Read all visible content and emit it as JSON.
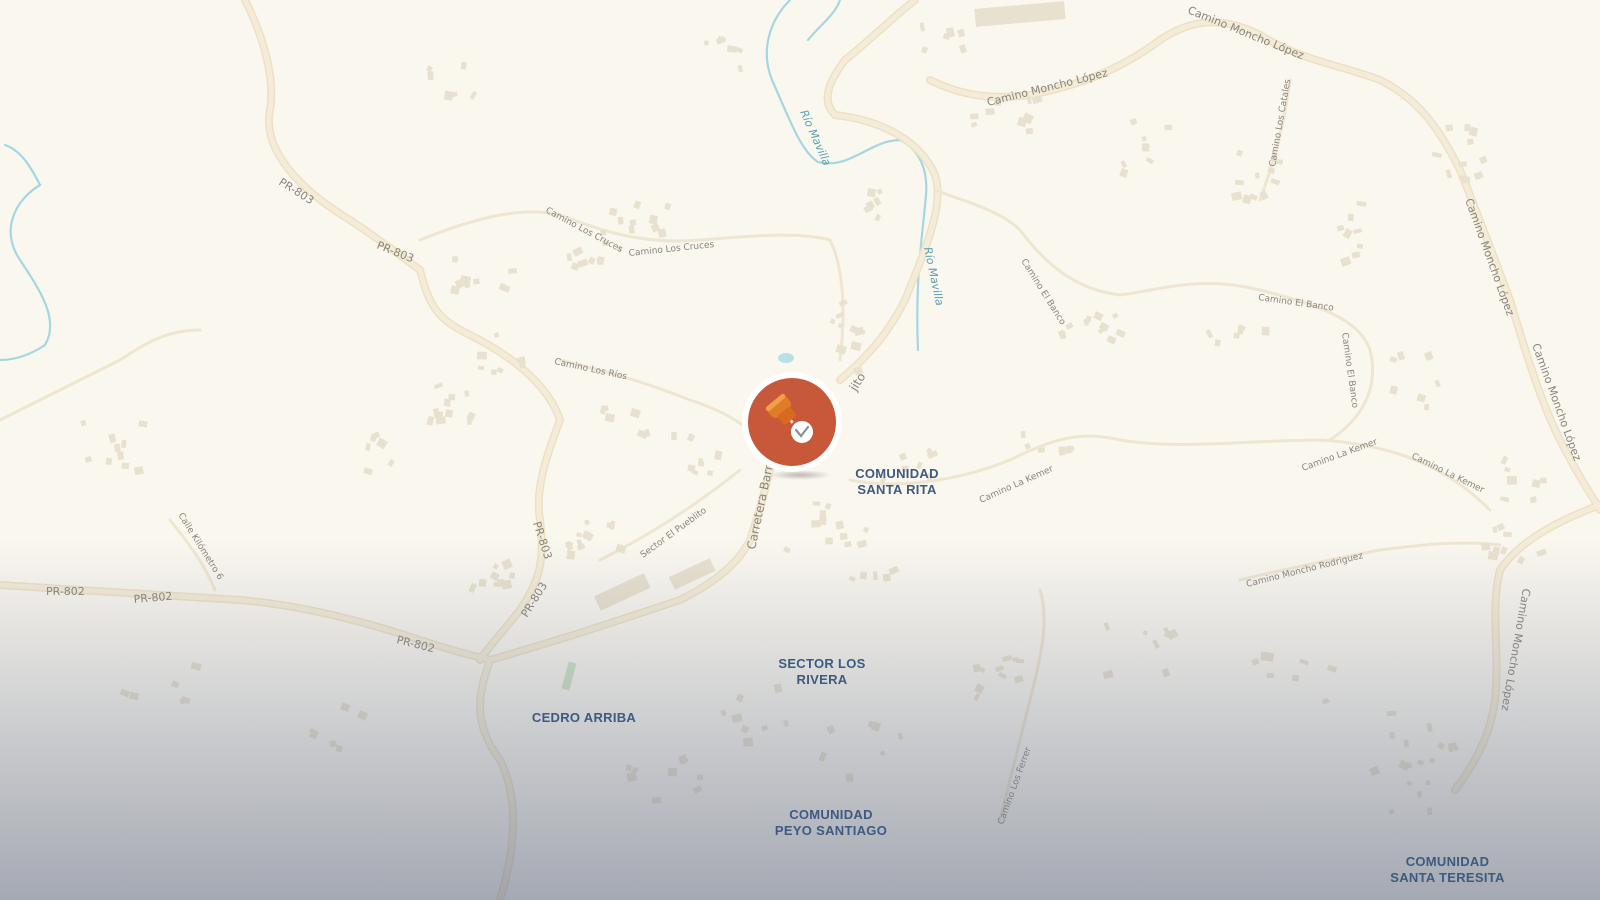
{
  "map": {
    "colors": {
      "land": "#faf7ef",
      "road": "#f1e8d2",
      "road_edge": "#e8dcc0",
      "river": "#9fd3e0",
      "building": "#ece5d6",
      "place_label": "#3d5a80",
      "marker": "#c8583a"
    },
    "roads": [
      {
        "key": "pr803_a",
        "label": "PR-803"
      },
      {
        "key": "pr803_b",
        "label": "PR-803"
      },
      {
        "key": "pr803_c",
        "label": "PR-803"
      },
      {
        "key": "pr803_d",
        "label": "PR-803"
      },
      {
        "key": "pr802_a",
        "label": "PR-802"
      },
      {
        "key": "pr802_b",
        "label": "PR-802"
      },
      {
        "key": "pr802_c",
        "label": "PR-802"
      },
      {
        "key": "cruces_a",
        "label": "Camino Los Cruces"
      },
      {
        "key": "cruces_b",
        "label": "Camino Los Cruces"
      },
      {
        "key": "rios",
        "label": "Camino Los Ríos"
      },
      {
        "key": "kilometro",
        "label": "Calle Kilómetro 6"
      },
      {
        "key": "pueblito",
        "label": "Sector El Pueblito"
      },
      {
        "key": "carretera",
        "label": "Carretera Barr"
      },
      {
        "key": "jito",
        "label": "jito"
      },
      {
        "key": "moncho_a",
        "label": "Camino Moncho López"
      },
      {
        "key": "moncho_b",
        "label": "Camino Moncho López"
      },
      {
        "key": "moncho_c",
        "label": "Camino Moncho López"
      },
      {
        "key": "moncho_d",
        "label": "Camino Moncho López"
      },
      {
        "key": "moncho_e",
        "label": "Camino Moncho López"
      },
      {
        "key": "catales",
        "label": "Camino Los Catales"
      },
      {
        "key": "banco_a",
        "label": "Camino El Banco"
      },
      {
        "key": "banco_b",
        "label": "Camino El Banco"
      },
      {
        "key": "banco_c",
        "label": "Camino El Banco"
      },
      {
        "key": "kemer_a",
        "label": "Camino La Kemer"
      },
      {
        "key": "kemer_b",
        "label": "Camino La Kemer"
      },
      {
        "key": "kemer_c",
        "label": "Camino La Kemer"
      },
      {
        "key": "rodriguez",
        "label": "Camino Moncho Rodriguez"
      },
      {
        "key": "ferrer",
        "label": "Camino Los Ferrer"
      }
    ],
    "rivers": [
      {
        "key": "mavilla_a",
        "label": "Río Mavilla"
      },
      {
        "key": "mavilla_b",
        "label": "Río Mavilla"
      }
    ],
    "places": [
      {
        "key": "santa_rita",
        "line1": "COMUNIDAD",
        "line2": "SANTA RITA"
      },
      {
        "key": "los_rivera",
        "line1": "SECTOR LOS",
        "line2": "RIVERA"
      },
      {
        "key": "cedro_arriba",
        "line1": "CEDRO ARRIBA",
        "line2": ""
      },
      {
        "key": "peyo_santiago",
        "line1": "COMUNIDAD",
        "line2": "PEYO SANTIAGO"
      },
      {
        "key": "santa_teresita",
        "line1": "COMUNIDAD",
        "line2": "SANTA TERESITA"
      }
    ],
    "marker": {
      "icon": "pushpin-icon"
    }
  }
}
